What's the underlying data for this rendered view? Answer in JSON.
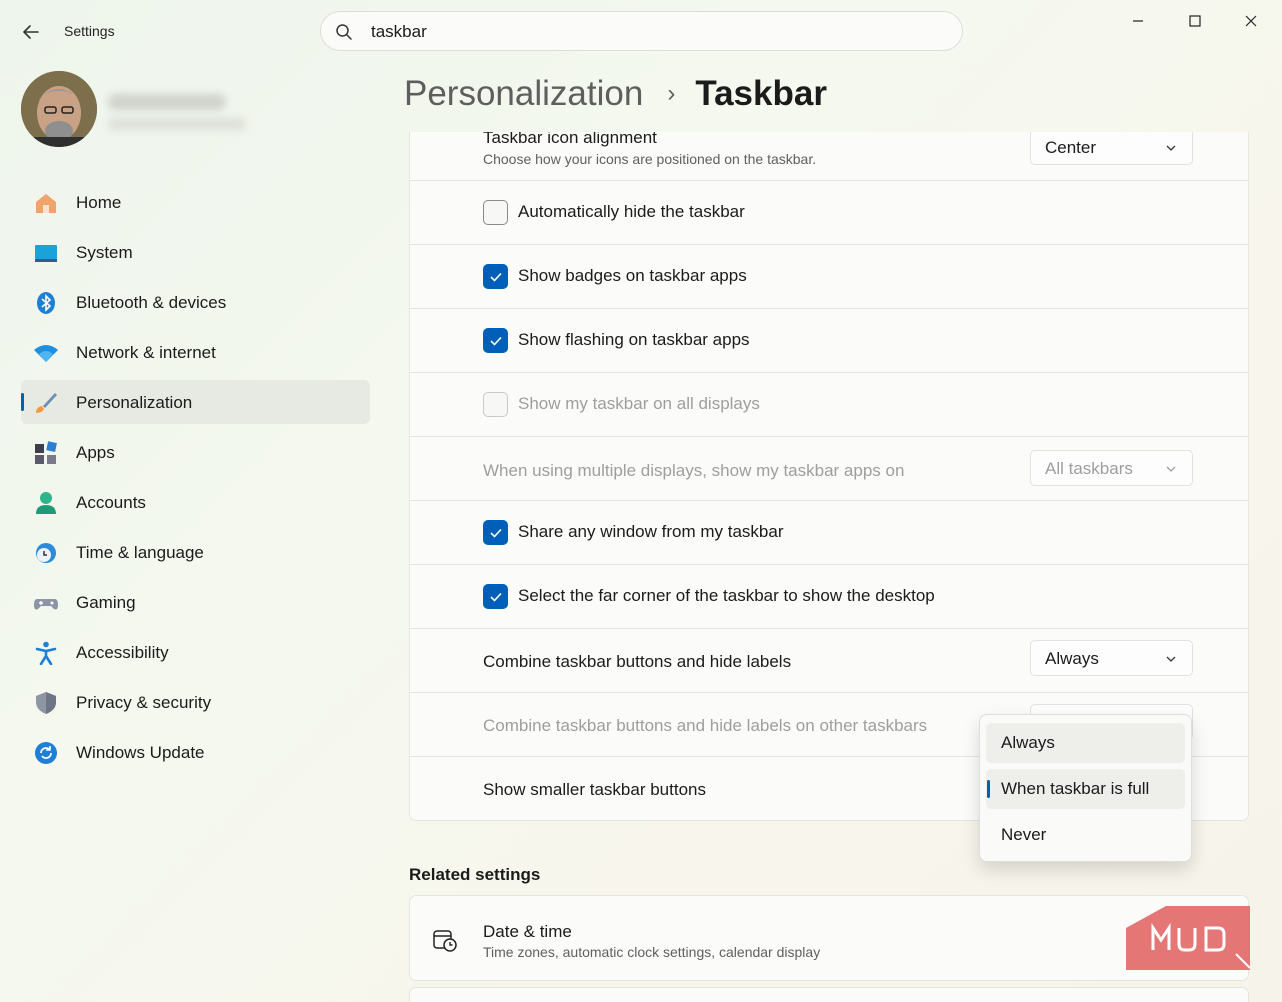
{
  "window": {
    "app_title": "Settings",
    "search": {
      "value": "taskbar"
    }
  },
  "profile": {
    "name": "",
    "email": ""
  },
  "sidebar": {
    "items": [
      {
        "label": "Home",
        "icon": "home-icon"
      },
      {
        "label": "System",
        "icon": "system-icon"
      },
      {
        "label": "Bluetooth & devices",
        "icon": "bluetooth-icon"
      },
      {
        "label": "Network & internet",
        "icon": "wifi-icon"
      },
      {
        "label": "Personalization",
        "icon": "brush-icon",
        "active": true
      },
      {
        "label": "Apps",
        "icon": "apps-icon"
      },
      {
        "label": "Accounts",
        "icon": "person-icon"
      },
      {
        "label": "Time & language",
        "icon": "clock-globe-icon"
      },
      {
        "label": "Gaming",
        "icon": "gamepad-icon"
      },
      {
        "label": "Accessibility",
        "icon": "accessibility-icon"
      },
      {
        "label": "Privacy & security",
        "icon": "shield-icon"
      },
      {
        "label": "Windows Update",
        "icon": "update-icon"
      }
    ]
  },
  "breadcrumb": {
    "parent": "Personalization",
    "separator": "›",
    "current": "Taskbar"
  },
  "settings": {
    "icon_alignment": {
      "label": "Taskbar icon alignment",
      "description": "Choose how your icons are positioned on the taskbar.",
      "value": "Center"
    },
    "auto_hide": {
      "label": "Automatically hide the taskbar",
      "checked": false
    },
    "badges": {
      "label": "Show badges on taskbar apps",
      "checked": true
    },
    "flashing": {
      "label": "Show flashing on taskbar apps",
      "checked": true
    },
    "all_displays": {
      "label": "Show my taskbar on all displays",
      "checked": false,
      "disabled": true
    },
    "multi_display": {
      "label": "When using multiple displays, show my taskbar apps on",
      "value": "All taskbars",
      "disabled": true
    },
    "share_window": {
      "label": "Share any window from my taskbar",
      "checked": true
    },
    "far_corner": {
      "label": "Select the far corner of the taskbar to show the desktop",
      "checked": true
    },
    "combine": {
      "label": "Combine taskbar buttons and hide labels",
      "value": "Always"
    },
    "combine_other": {
      "label": "Combine taskbar buttons and hide labels on other taskbars",
      "disabled": true
    },
    "smaller_buttons": {
      "label": "Show smaller taskbar buttons"
    }
  },
  "dropdown_menu": {
    "options": [
      "Always",
      "When taskbar is full",
      "Never"
    ],
    "selected": "When taskbar is full"
  },
  "related": {
    "title": "Related settings",
    "items": [
      {
        "title": "Date & time",
        "description": "Time zones, automatic clock settings, calendar display"
      }
    ]
  },
  "watermark": {
    "text": "MUO"
  },
  "colors": {
    "accent": "#005fb8",
    "watermark": "#e36a6a"
  }
}
